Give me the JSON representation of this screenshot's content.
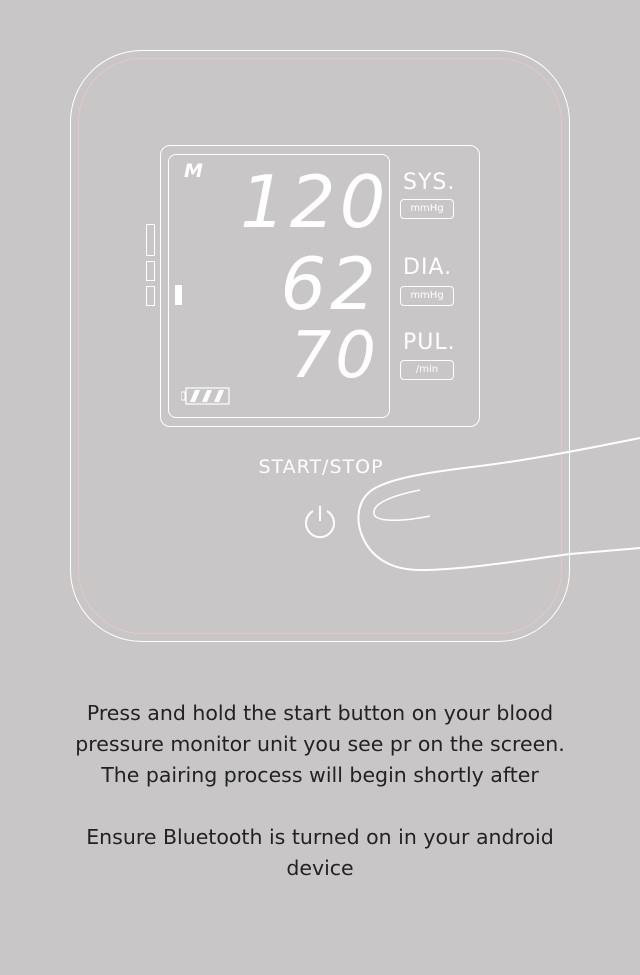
{
  "monitor": {
    "memory_label": "M",
    "systolic": "120",
    "diastolic": "62",
    "pulse": "70",
    "sys_label": "SYS.",
    "sys_unit": "mmHg",
    "dia_label": "DIA.",
    "dia_unit": "mmHg",
    "pul_label": "PUL.",
    "pul_unit": "/min",
    "start_stop_label": "START/STOP",
    "battery_icon": "battery-full-icon",
    "power_icon": "power-icon"
  },
  "instructions": {
    "step1": "Press and hold the start button on your blood pressure monitor unit you see pr on the screen. The pairing process will begin shortly after",
    "step2": "Ensure Bluetooth is turned on in your android device"
  },
  "colors": {
    "background": "#c8c6c6",
    "outline": "#ffffff",
    "text": "#222222"
  }
}
